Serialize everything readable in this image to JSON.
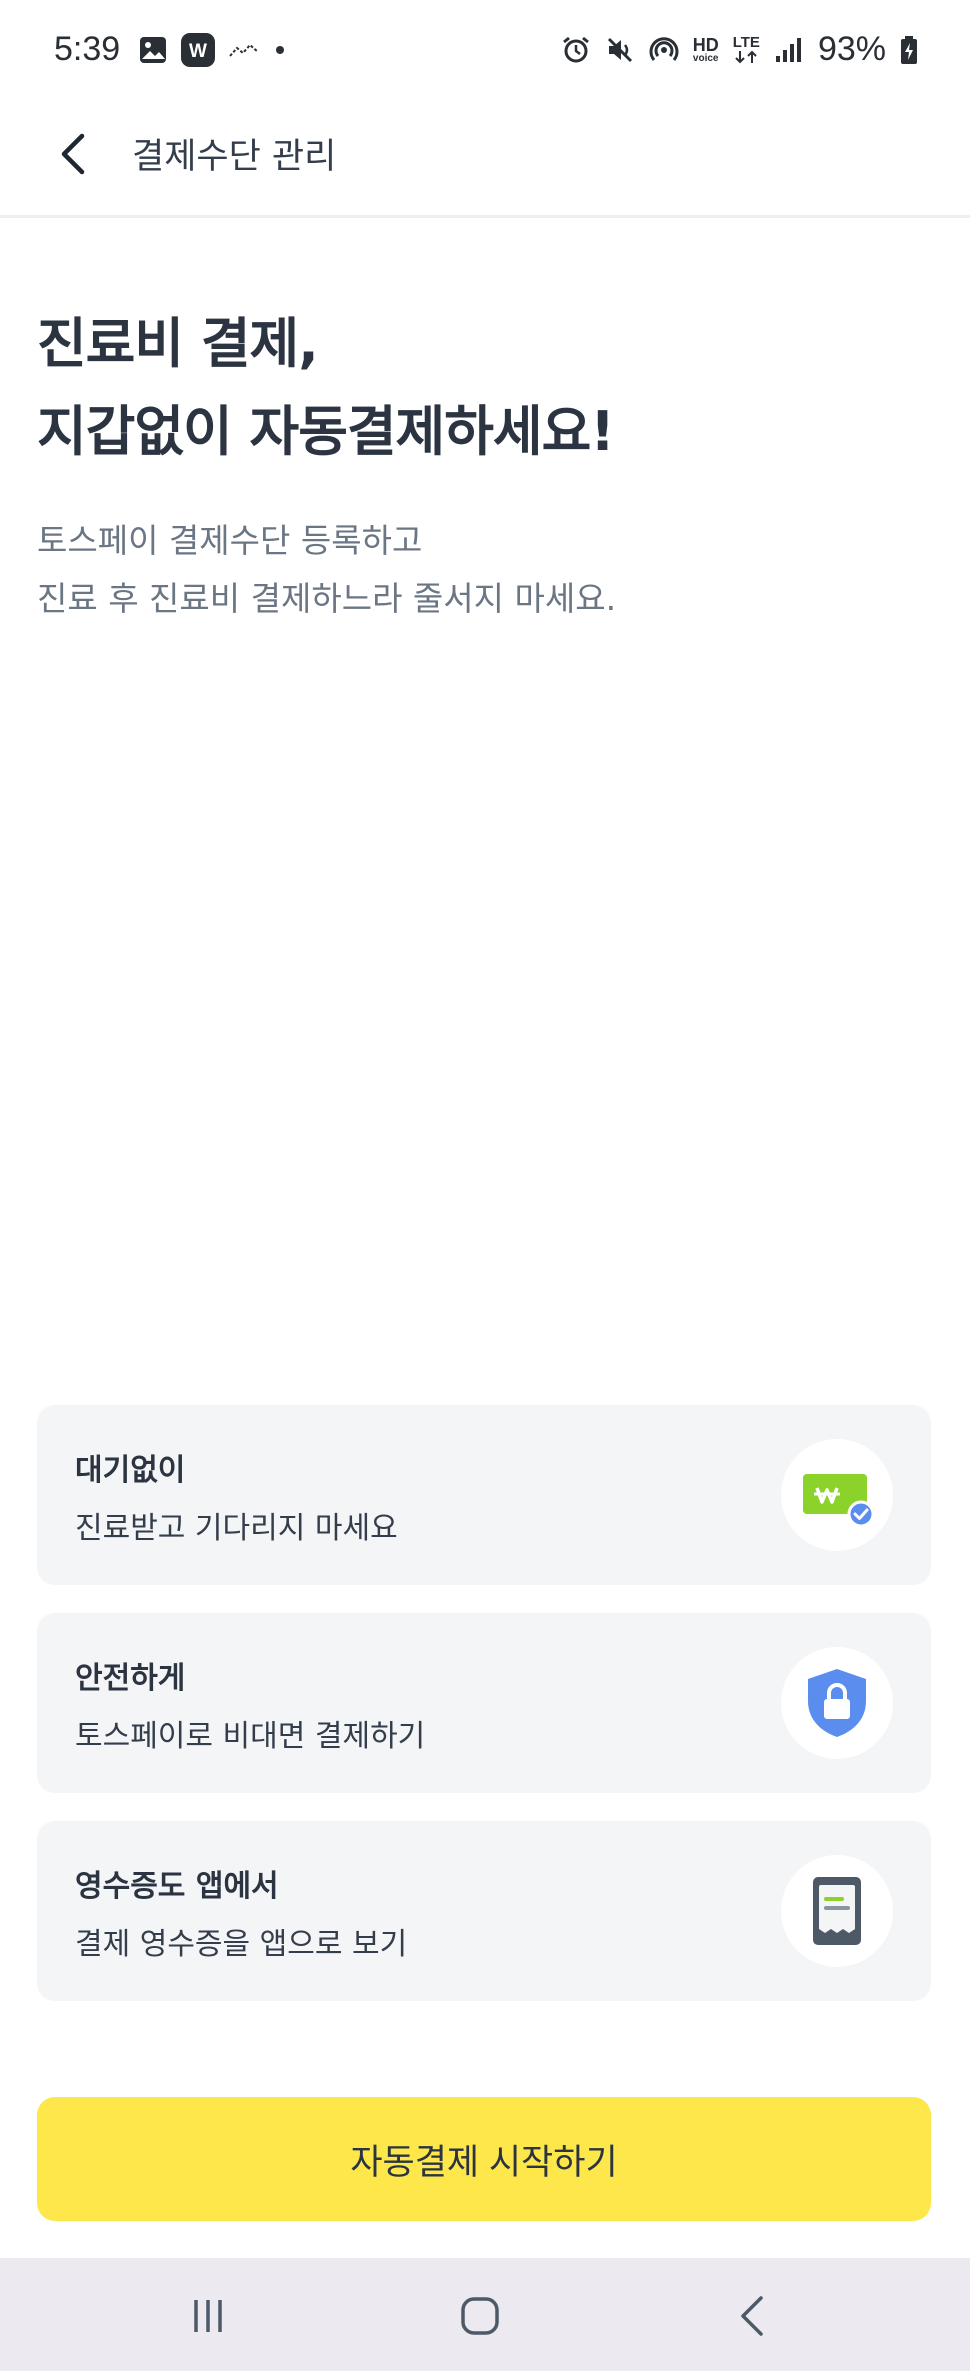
{
  "status_bar": {
    "time": "5:39",
    "battery": "93%",
    "hd_label": "HD",
    "voice_label": "voice",
    "lte_label": "LTE",
    "left_icons": [
      "gallery-icon",
      "w-app-icon",
      "activity-icon",
      "dot-icon"
    ],
    "right_icons": [
      "alarm-icon",
      "mute-icon",
      "hotspot-icon",
      "hd-voice-icon",
      "lte-icon",
      "signal-icon",
      "battery-charging-icon"
    ]
  },
  "header": {
    "title": "결제수단 관리",
    "back_icon": "chevron-left-icon"
  },
  "hero": {
    "title_line1": "진료비 결제,",
    "title_line2": "지갑없이 자동결제하세요!",
    "desc_line1": "토스페이 결제수단 등록하고",
    "desc_line2": "진료 후 진료비 결제하느라 줄서지 마세요."
  },
  "features": [
    {
      "title": "대기없이",
      "subtitle": "진료받고 기다리지 마세요",
      "icon": "won-bill-check-icon"
    },
    {
      "title": "안전하게",
      "subtitle": "토스페이로 비대면 결제하기",
      "icon": "shield-lock-icon"
    },
    {
      "title": "영수증도 앱에서",
      "subtitle": "결제 영수증을 앱으로 보기",
      "icon": "receipt-icon"
    }
  ],
  "cta": {
    "label": "자동결제 시작하기"
  },
  "nav": {
    "icons": [
      "recent-apps-icon",
      "home-icon",
      "back-icon"
    ]
  },
  "colors": {
    "accent": "#fde74a",
    "card_bg": "#f4f5f7",
    "shield": "#5b8def",
    "bill_green": "#8bd22b"
  }
}
